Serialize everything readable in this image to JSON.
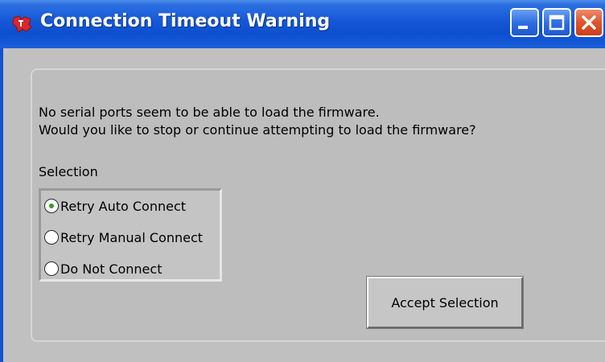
{
  "window": {
    "title": "Connection Timeout Warning",
    "app_icon": "ti-logo-icon",
    "controls": [
      "minimize-icon",
      "maximize-icon",
      "close-icon"
    ],
    "colors": {
      "titlebar": "#1556d6",
      "close": "#e0532c",
      "body": "#c0c0c0"
    }
  },
  "message": {
    "line1": "No serial ports seem to be able to load the firmware.",
    "line2": "Would you like to stop or continue attempting to load the firmware?"
  },
  "selection": {
    "label": "Selection",
    "options": [
      {
        "label": "Retry Auto Connect",
        "selected": true
      },
      {
        "label": "Retry Manual Connect",
        "selected": false
      },
      {
        "label": "Do Not Connect",
        "selected": false
      }
    ]
  },
  "actions": {
    "accept_label": "Accept Selection"
  }
}
